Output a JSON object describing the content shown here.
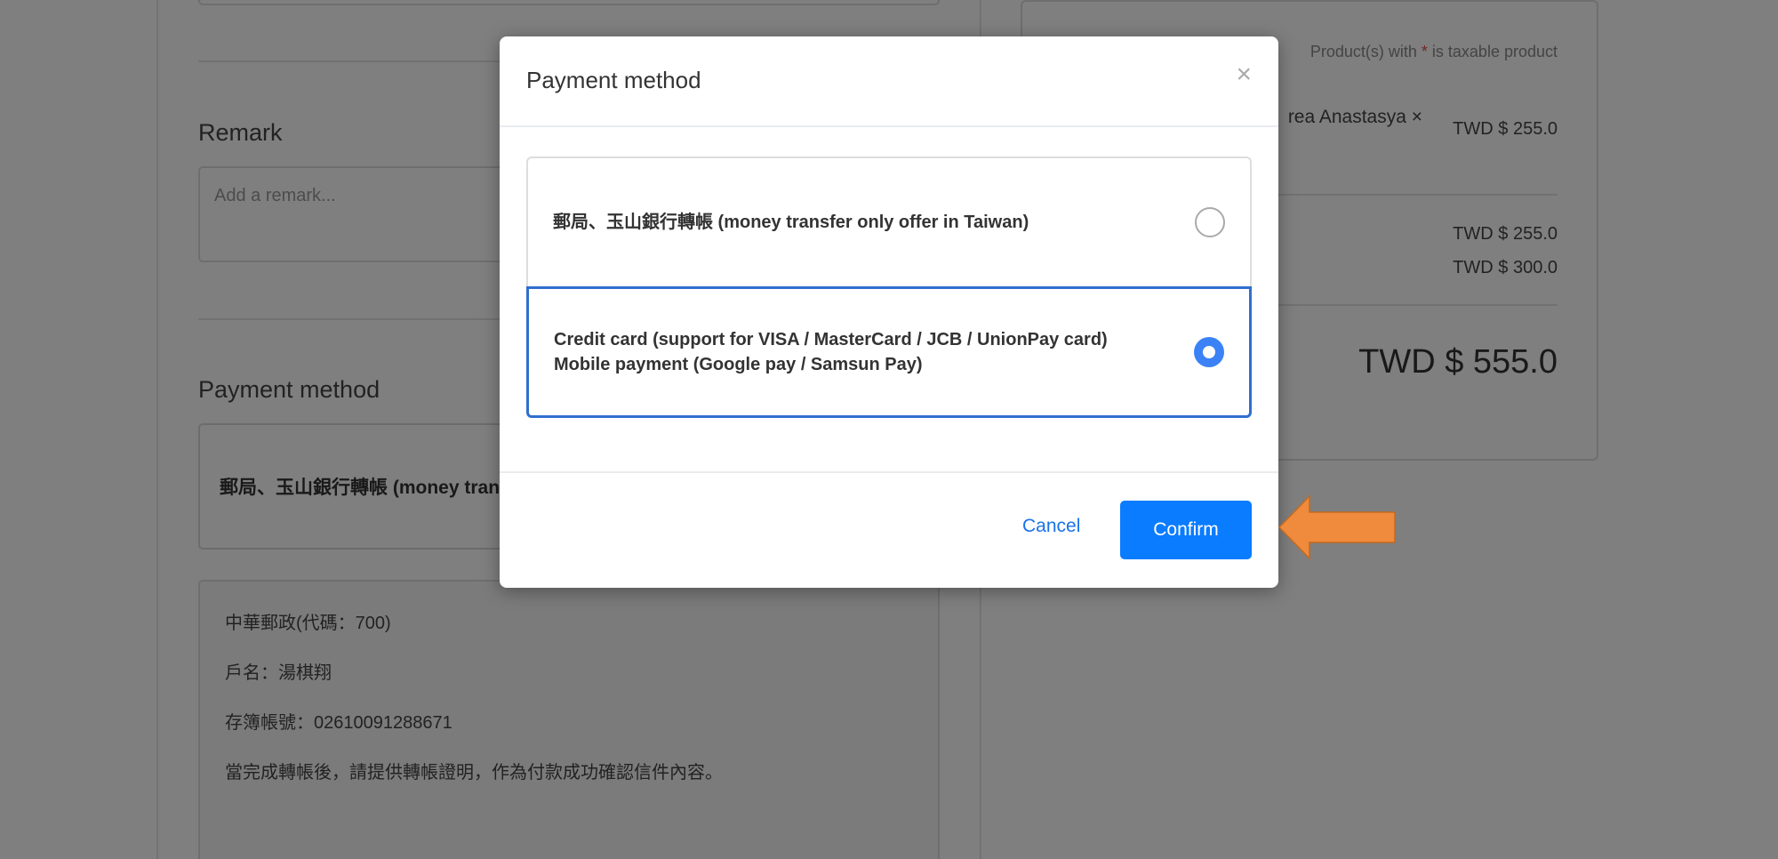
{
  "page": {
    "remark": {
      "title": "Remark",
      "placeholder": "Add a remark..."
    },
    "payment_section": {
      "title": "Payment method",
      "selected_method": "郵局、玉山銀行轉帳 (money transfer only offer in Taiwan)"
    },
    "transfer_info": [
      "中華郵政(代碼：700)",
      "戶名：湯棋翔",
      "存簿帳號：02610091288671",
      "當完成轉帳後，請提供轉帳證明，作為付款成功確認信件內容。"
    ],
    "summary": {
      "taxable_note_prefix": "Product(s) with ",
      "taxable_note_star": "*",
      "taxable_note_suffix": " is taxable product",
      "product_line": "rea Anastasya ×",
      "product_amount": "TWD $ 255.0",
      "subtotal": "TWD $ 255.0",
      "shipping": "TWD $ 300.0",
      "total": "TWD $ 555.0"
    }
  },
  "modal": {
    "title": "Payment method",
    "close_symbol": "×",
    "options": [
      {
        "line1": "郵局、玉山銀行轉帳 (money transfer only offer in Taiwan)",
        "line2": "",
        "selected": false
      },
      {
        "line1": "Credit card (support for VISA / MasterCard / JCB / UnionPay card)",
        "line2": "Mobile payment (Google pay / Samsun Pay)",
        "selected": true
      }
    ],
    "cancel_label": "Cancel",
    "confirm_label": "Confirm"
  },
  "colors": {
    "accent": "#0a7cff",
    "selected_border": "#2f6fcf",
    "annotation_arrow": "#f08a3c"
  }
}
